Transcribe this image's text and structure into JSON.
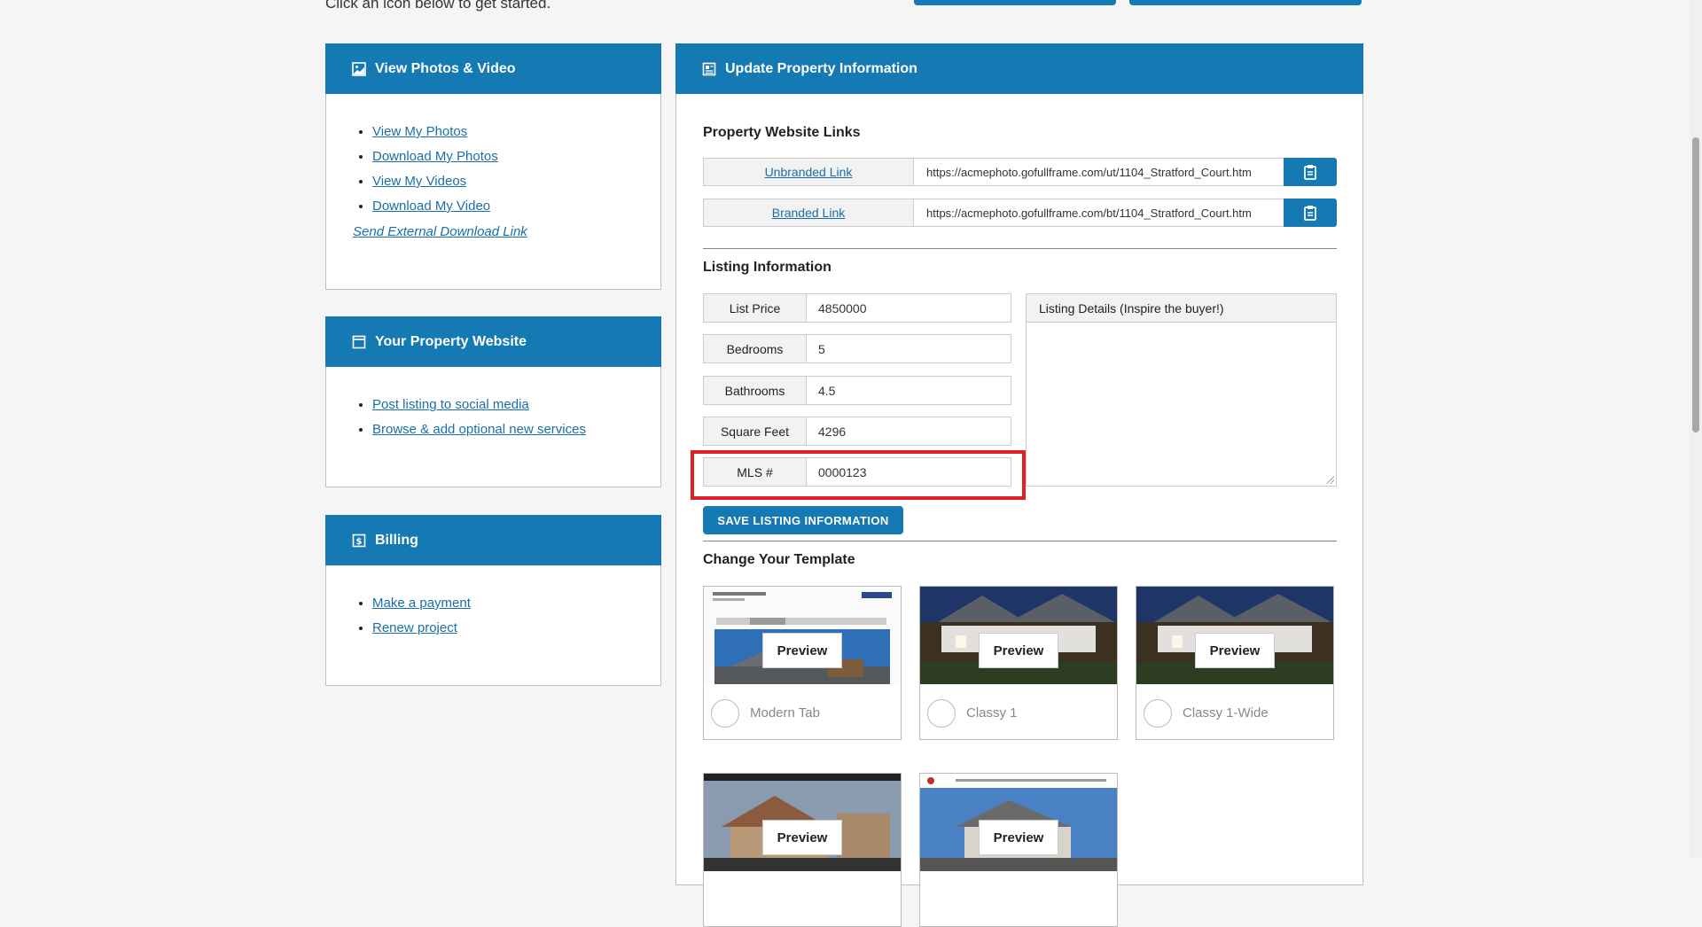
{
  "intro_text": "Click an icon below to get started.",
  "photos_panel": {
    "title": "View Photos & Video",
    "links": [
      "View My Photos",
      "Download My Photos",
      "View My Videos",
      "Download My Video"
    ],
    "external_link": "Send External Download Link"
  },
  "website_panel": {
    "title": "Your Property Website",
    "links": [
      "Post listing to social media",
      "Browse & add optional new services"
    ]
  },
  "billing_panel": {
    "title": "Billing",
    "links": [
      "Make a payment",
      "Renew project"
    ]
  },
  "main": {
    "title": "Update Property Information",
    "website_links_title": "Property Website Links",
    "unbranded": {
      "label": "Unbranded Link",
      "url": "https://acmephoto.gofullframe.com/ut/1104_Stratford_Court.htm"
    },
    "branded": {
      "label": "Branded Link",
      "url": "https://acmephoto.gofullframe.com/bt/1104_Stratford_Court.htm"
    },
    "listing_title": "Listing Information",
    "fields": [
      {
        "label": "List Price",
        "value": "4850000"
      },
      {
        "label": "Bedrooms",
        "value": "5"
      },
      {
        "label": "Bathrooms",
        "value": "4.5"
      },
      {
        "label": "Square Feet",
        "value": "4296"
      },
      {
        "label": "MLS #",
        "value": "0000123"
      }
    ],
    "details_label": "Listing Details (Inspire the buyer!)",
    "save_label": "SAVE LISTING INFORMATION",
    "template_title": "Change Your Template",
    "preview_label": "Preview",
    "templates": [
      "Modern Tab",
      "Classy 1",
      "Classy 1-Wide",
      "",
      ""
    ]
  },
  "colors": {
    "accent": "#1579b3",
    "highlight": "#e0202a"
  }
}
